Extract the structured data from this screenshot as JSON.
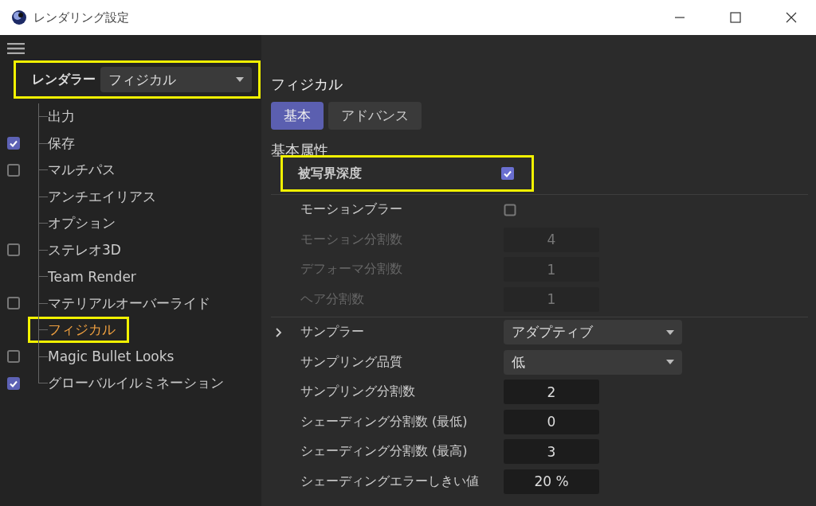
{
  "window": {
    "title": "レンダリング設定"
  },
  "renderer": {
    "label": "レンダラー",
    "value": "フィジカル",
    "highlighted": true
  },
  "sidebar": {
    "items": [
      {
        "label": "出力",
        "kind": "plain",
        "selected": false,
        "highlighted": false
      },
      {
        "label": "保存",
        "kind": "checkbox",
        "checked": true,
        "selected": false,
        "highlighted": false
      },
      {
        "label": "マルチパス",
        "kind": "checkbox",
        "checked": false,
        "selected": false,
        "highlighted": false
      },
      {
        "label": "アンチエイリアス",
        "kind": "plain",
        "selected": false,
        "highlighted": false
      },
      {
        "label": "オプション",
        "kind": "plain",
        "selected": false,
        "highlighted": false
      },
      {
        "label": "ステレオ3D",
        "kind": "checkbox",
        "checked": false,
        "selected": false,
        "highlighted": false
      },
      {
        "label": "Team Render",
        "kind": "plain",
        "selected": false,
        "highlighted": false
      },
      {
        "label": "マテリアルオーバーライド",
        "kind": "checkbox",
        "checked": false,
        "selected": false,
        "highlighted": false
      },
      {
        "label": "フィジカル",
        "kind": "plain",
        "selected": true,
        "highlighted": true
      },
      {
        "label": "Magic Bullet Looks",
        "kind": "checkbox",
        "checked": false,
        "selected": false,
        "highlighted": false
      },
      {
        "label": "グローバルイルミネーション",
        "kind": "checkbox",
        "checked": true,
        "selected": false,
        "highlighted": false
      }
    ]
  },
  "panel": {
    "title": "フィジカル",
    "tabs": [
      {
        "label": "基本",
        "selected": true
      },
      {
        "label": "アドバンス",
        "selected": false
      }
    ],
    "section_title": "基本属性",
    "property_groups": [
      {
        "properties": [
          {
            "label": "被写界深度",
            "kind": "checkbox",
            "checked": true,
            "disabled": false,
            "highlighted": true
          }
        ]
      },
      {
        "properties": [
          {
            "label": "モーションブラー",
            "kind": "checkbox",
            "checked": false,
            "disabled": false,
            "highlighted": false
          },
          {
            "label": "モーション分割数",
            "kind": "number",
            "value": "4",
            "disabled": true,
            "highlighted": false
          },
          {
            "label": "デフォーマ分割数",
            "kind": "number",
            "value": "1",
            "disabled": true,
            "highlighted": false
          },
          {
            "label": "ヘア分割数",
            "kind": "number",
            "value": "1",
            "disabled": true,
            "highlighted": false
          }
        ]
      },
      {
        "properties": [
          {
            "label": "サンプラー",
            "kind": "dropdown",
            "value": "アダプティブ",
            "disabled": false,
            "highlighted": false,
            "expanded": false
          },
          {
            "label": "サンプリング品質",
            "kind": "dropdown",
            "value": "低",
            "disabled": false,
            "highlighted": false
          },
          {
            "label": "サンプリング分割数",
            "kind": "number",
            "value": "2",
            "disabled": false,
            "highlighted": false
          },
          {
            "label": "シェーディング分割数 (最低)",
            "kind": "number",
            "value": "0",
            "disabled": false,
            "highlighted": false
          },
          {
            "label": "シェーディング分割数 (最高)",
            "kind": "number",
            "value": "3",
            "disabled": false,
            "highlighted": false
          },
          {
            "label": "シェーディングエラーしきい値",
            "kind": "number",
            "value": "20 %",
            "disabled": false,
            "highlighted": false
          }
        ]
      }
    ]
  }
}
